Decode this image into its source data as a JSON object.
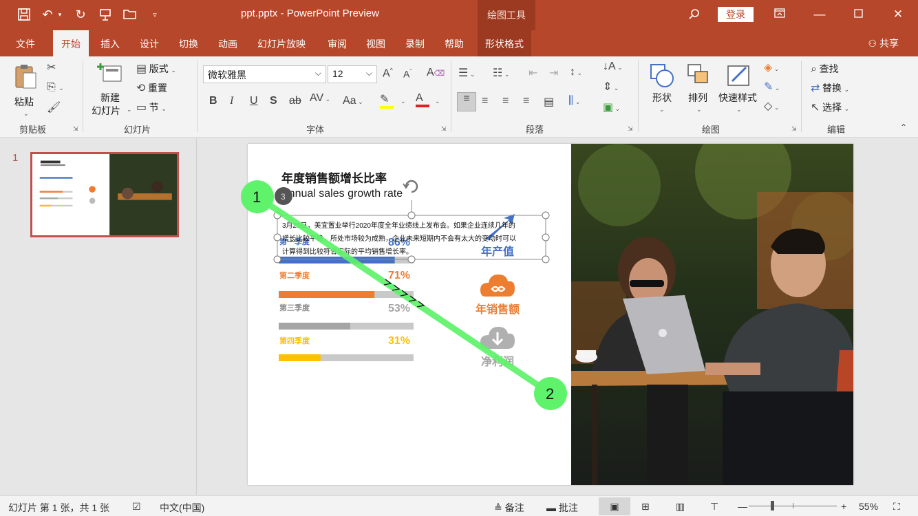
{
  "titlebar": {
    "title": "ppt.pptx  -  PowerPoint Preview",
    "drawing_tools": "绘图工具",
    "login": "登录"
  },
  "tabs": [
    "文件",
    "开始",
    "插入",
    "设计",
    "切换",
    "动画",
    "幻灯片放映",
    "审阅",
    "视图",
    "录制",
    "帮助",
    "形状格式"
  ],
  "share": "共享",
  "ribbon": {
    "clipboard": {
      "paste": "粘贴",
      "label": "剪贴板"
    },
    "slides": {
      "new_slide_1": "新建",
      "new_slide_2": "幻灯片",
      "layout": "版式",
      "reset": "重置",
      "section": "节",
      "label": "幻灯片"
    },
    "font": {
      "font_name": "微软雅黑",
      "font_size": "12",
      "label": "字体"
    },
    "paragraph": {
      "label": "段落"
    },
    "drawing": {
      "shapes": "形状",
      "arrange": "排列",
      "quick_styles": "快速样式",
      "label": "绘图"
    },
    "editing": {
      "find": "查找",
      "replace": "替换",
      "select": "选择",
      "label": "编辑"
    }
  },
  "thumbnail": {
    "number": "1"
  },
  "slide": {
    "title": "年度销售额增长比率",
    "subtitle": "Annual sales growth rate",
    "anim_badge": "3",
    "body_text_1": "3月25日，美宜置业举行2020年度全年业绩线上发布会。如果企业连续几年的",
    "body_text_2": "增长比较平稳，所处市场较为成熟，企业未来短期内不会有太大的变动时可以",
    "body_text_3": "计算得到比较符合实际的平均销售增长率。",
    "q1_label": "第一季度",
    "q1_pct": "86%",
    "q2_label": "第二季度",
    "q2_pct": "71%",
    "q3_label": "第三季度",
    "q3_pct": "53%",
    "q4_label": "第四季度",
    "q4_pct": "31%",
    "annual_output": "年产值",
    "annual_sales": "年销售额",
    "net_profit": "净利润",
    "progress": {
      "q1": 0.86,
      "q2": 0.71,
      "q3": 0.53,
      "q4": 0.31
    }
  },
  "drag_markers": {
    "start": "1",
    "end": "2"
  },
  "statusbar": {
    "slide_info": "幻灯片 第 1 张，共 1 张",
    "language": "中文(中国)",
    "notes": "备注",
    "comments": "批注",
    "zoom": "55%"
  },
  "colors": {
    "brand": "#b7472a",
    "orange": "#ed7d31",
    "blue": "#4472c4",
    "gray": "#a5a5a5",
    "yellow": "#ffc000",
    "drag_green": "#5ef36a"
  }
}
